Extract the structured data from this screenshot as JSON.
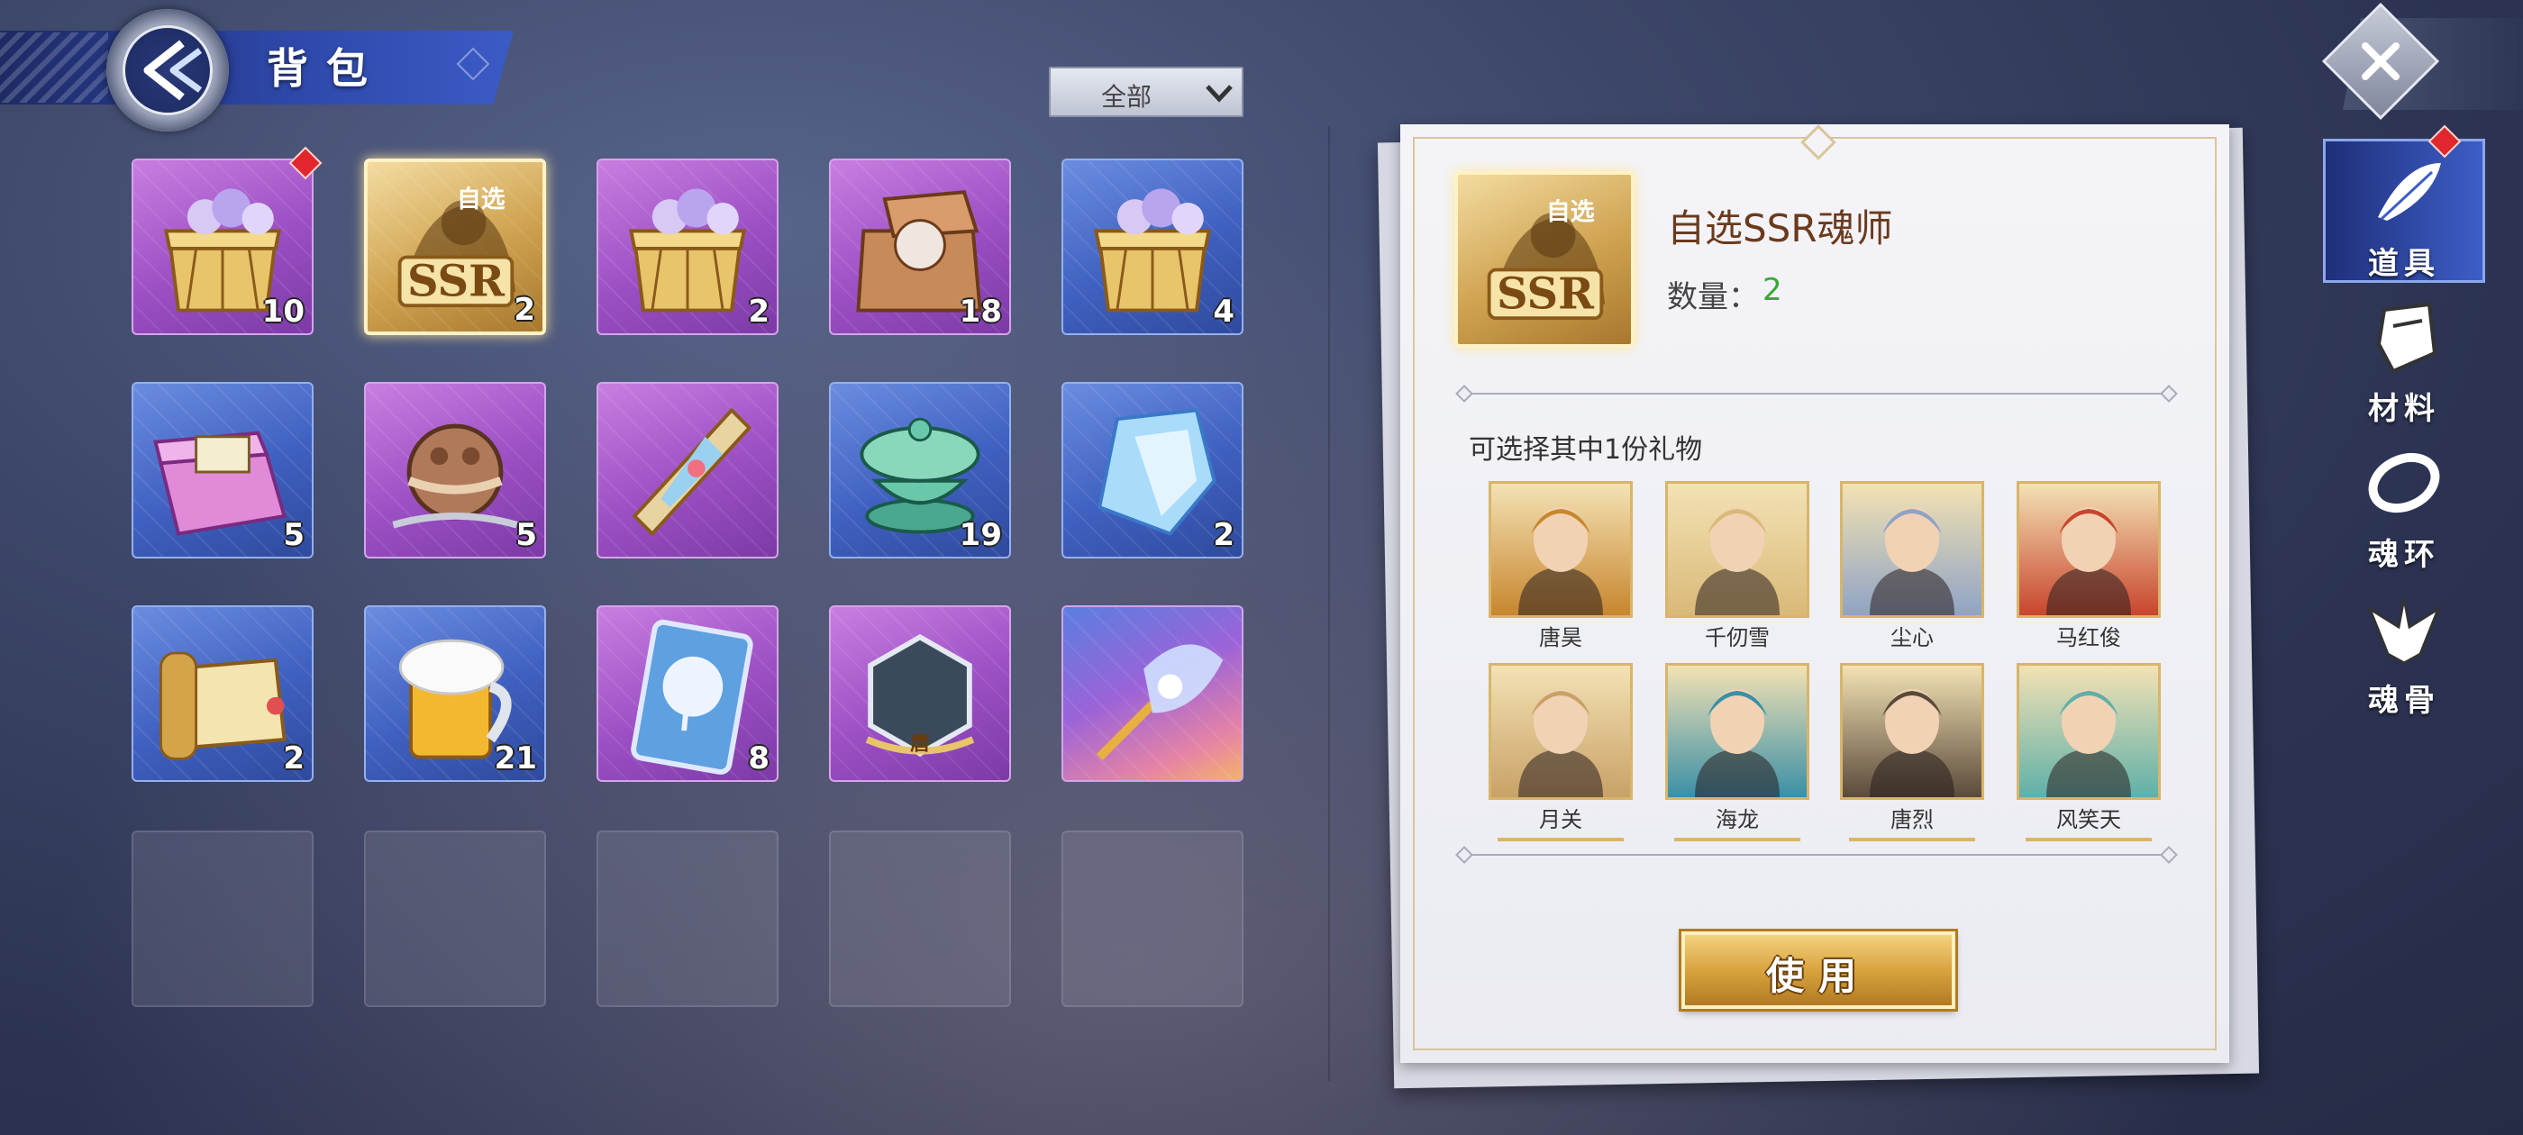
{
  "header": {
    "title": "背包"
  },
  "filter": {
    "selected": "全部"
  },
  "inventory": [
    {
      "count": "10",
      "rarity": "purple",
      "icon": "flower-chest-icon",
      "new": true
    },
    {
      "count": "2",
      "rarity": "gold",
      "icon": "ssr-selector-icon",
      "label": "自选",
      "badge": "SSR",
      "selected": true
    },
    {
      "count": "2",
      "rarity": "purple",
      "icon": "flower-chest-icon"
    },
    {
      "count": "18",
      "rarity": "purple",
      "icon": "open-crate-icon"
    },
    {
      "count": "4",
      "rarity": "blue",
      "icon": "flower-chest-icon"
    },
    {
      "count": "5",
      "rarity": "blue",
      "icon": "gift-box-icon"
    },
    {
      "count": "5",
      "rarity": "purple",
      "icon": "bronze-orb-icon"
    },
    {
      "count": "",
      "rarity": "purple",
      "icon": "crystal-blade-icon"
    },
    {
      "count": "19",
      "rarity": "blue",
      "icon": "jade-bowl-icon"
    },
    {
      "count": "2",
      "rarity": "blue",
      "icon": "ice-crystal-icon"
    },
    {
      "count": "2",
      "rarity": "blue",
      "icon": "scroll-icon"
    },
    {
      "count": "21",
      "rarity": "blue",
      "icon": "beer-mug-icon"
    },
    {
      "count": "8",
      "rarity": "purple",
      "icon": "tree-card-icon"
    },
    {
      "count": "",
      "rarity": "purple",
      "icon": "hexagon-frame-icon",
      "label": "唐"
    },
    {
      "count": "",
      "rarity": "rainbow",
      "icon": "whisk-icon"
    },
    {
      "count": "",
      "rarity": "empty"
    },
    {
      "count": "",
      "rarity": "empty"
    },
    {
      "count": "",
      "rarity": "empty"
    },
    {
      "count": "",
      "rarity": "empty"
    },
    {
      "count": "",
      "rarity": "empty"
    }
  ],
  "detail": {
    "name": "自选SSR魂师",
    "icon_label": "自选",
    "icon_badge": "SSR",
    "qty_label": "数量：",
    "qty_value": "2",
    "choose_text": "可选择其中1份礼物",
    "heroes": [
      {
        "name": "唐昊",
        "color": "#c8862e"
      },
      {
        "name": "千仞雪",
        "color": "#d9b978"
      },
      {
        "name": "尘心",
        "color": "#8fa3c4"
      },
      {
        "name": "马红俊",
        "color": "#c8452e"
      },
      {
        "name": "月关",
        "color": "#c9a167"
      },
      {
        "name": "海龙",
        "color": "#3a8fa6"
      },
      {
        "name": "唐烈",
        "color": "#5a4a3a"
      },
      {
        "name": "风笑天",
        "color": "#5fb0a8"
      }
    ],
    "use_button": "使用"
  },
  "tabs": [
    {
      "label": "道具",
      "icon": "feather-icon",
      "active": true,
      "new": true
    },
    {
      "label": "材料",
      "icon": "armor-icon"
    },
    {
      "label": "魂环",
      "icon": "ring-icon"
    },
    {
      "label": "魂骨",
      "icon": "bone-wings-icon"
    }
  ]
}
